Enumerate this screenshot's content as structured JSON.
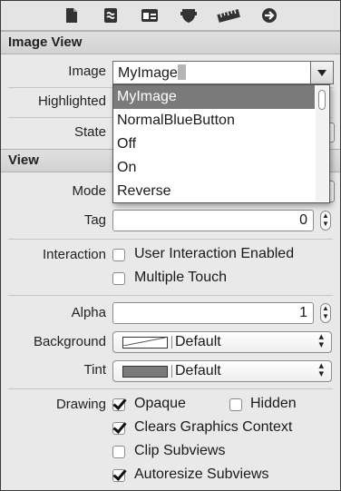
{
  "toolbar": {
    "icons": [
      "file-icon",
      "quick-help-icon",
      "identity-icon",
      "attributes-icon",
      "size-ruler-icon",
      "connections-arrow-icon"
    ]
  },
  "image_view": {
    "section_title": "Image View",
    "image_label": "Image",
    "image_value": "MyImage",
    "highlighted_label": "Highlighted",
    "state_label": "State",
    "dropdown_items": [
      "MyImage",
      "NormalBlueButton",
      "Off",
      "On",
      "Reverse"
    ],
    "dropdown_selected_index": 0
  },
  "view": {
    "section_title": "View",
    "mode_label": "Mode",
    "tag_label": "Tag",
    "tag_value": "0",
    "interaction_label": "Interaction",
    "user_interaction_label": "User Interaction Enabled",
    "user_interaction_checked": false,
    "multiple_touch_label": "Multiple Touch",
    "multiple_touch_checked": false,
    "alpha_label": "Alpha",
    "alpha_value": "1",
    "background_label": "Background",
    "background_value": "Default",
    "tint_label": "Tint",
    "tint_value": "Default",
    "drawing_label": "Drawing",
    "opaque_label": "Opaque",
    "opaque_checked": true,
    "hidden_label": "Hidden",
    "hidden_checked": false,
    "clears_label": "Clears Graphics Context",
    "clears_checked": true,
    "clip_label": "Clip Subviews",
    "clip_checked": false,
    "autoresize_label": "Autoresize Subviews",
    "autoresize_checked": true
  },
  "colors": {
    "background_swatch": "#ffffff",
    "tint_swatch": "#7a7a7a",
    "menu_highlight": "#7a7a7a"
  }
}
